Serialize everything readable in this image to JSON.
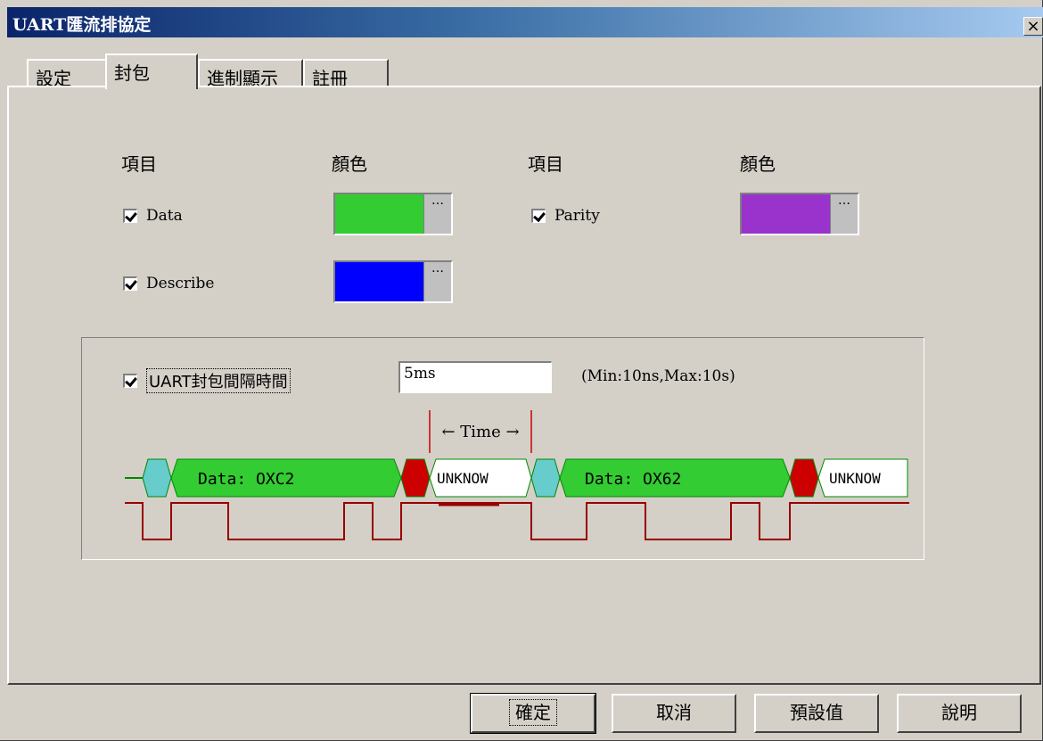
{
  "window": {
    "title": "UART匯流排協定",
    "close_glyph": "×"
  },
  "tabs": [
    {
      "label": "設定"
    },
    {
      "label": "封包"
    },
    {
      "label": "進制顯示"
    },
    {
      "label": "註冊"
    }
  ],
  "headers": {
    "item_left": "項目",
    "color_left": "顏色",
    "item_right": "項目",
    "color_right": "顏色"
  },
  "items": {
    "data": {
      "label": "Data",
      "checked": true,
      "color": "#33cc33"
    },
    "describe": {
      "label": "Describe",
      "checked": true,
      "color": "#0000ff"
    },
    "parity": {
      "label": "Parity",
      "checked": true,
      "color": "#9933cc"
    },
    "dots": "…"
  },
  "interval": {
    "label": "UART封包間隔時間",
    "checked": true,
    "value": "5ms",
    "range_hint": "(Min:10ns,Max:10s)"
  },
  "diagram": {
    "time_label": "← Time →",
    "packets": [
      "Data: OXC2",
      "UNKNOW",
      "Data: OX62",
      "UNKNOW"
    ],
    "colors": {
      "start": "#66cccc",
      "data": "#33cc33",
      "parity": "#cc0000",
      "gap": "#ffffff",
      "signal": "#990000",
      "line": "#008800"
    }
  },
  "buttons": {
    "ok": "確定",
    "cancel": "取消",
    "defaults": "預設值",
    "help": "說明"
  }
}
